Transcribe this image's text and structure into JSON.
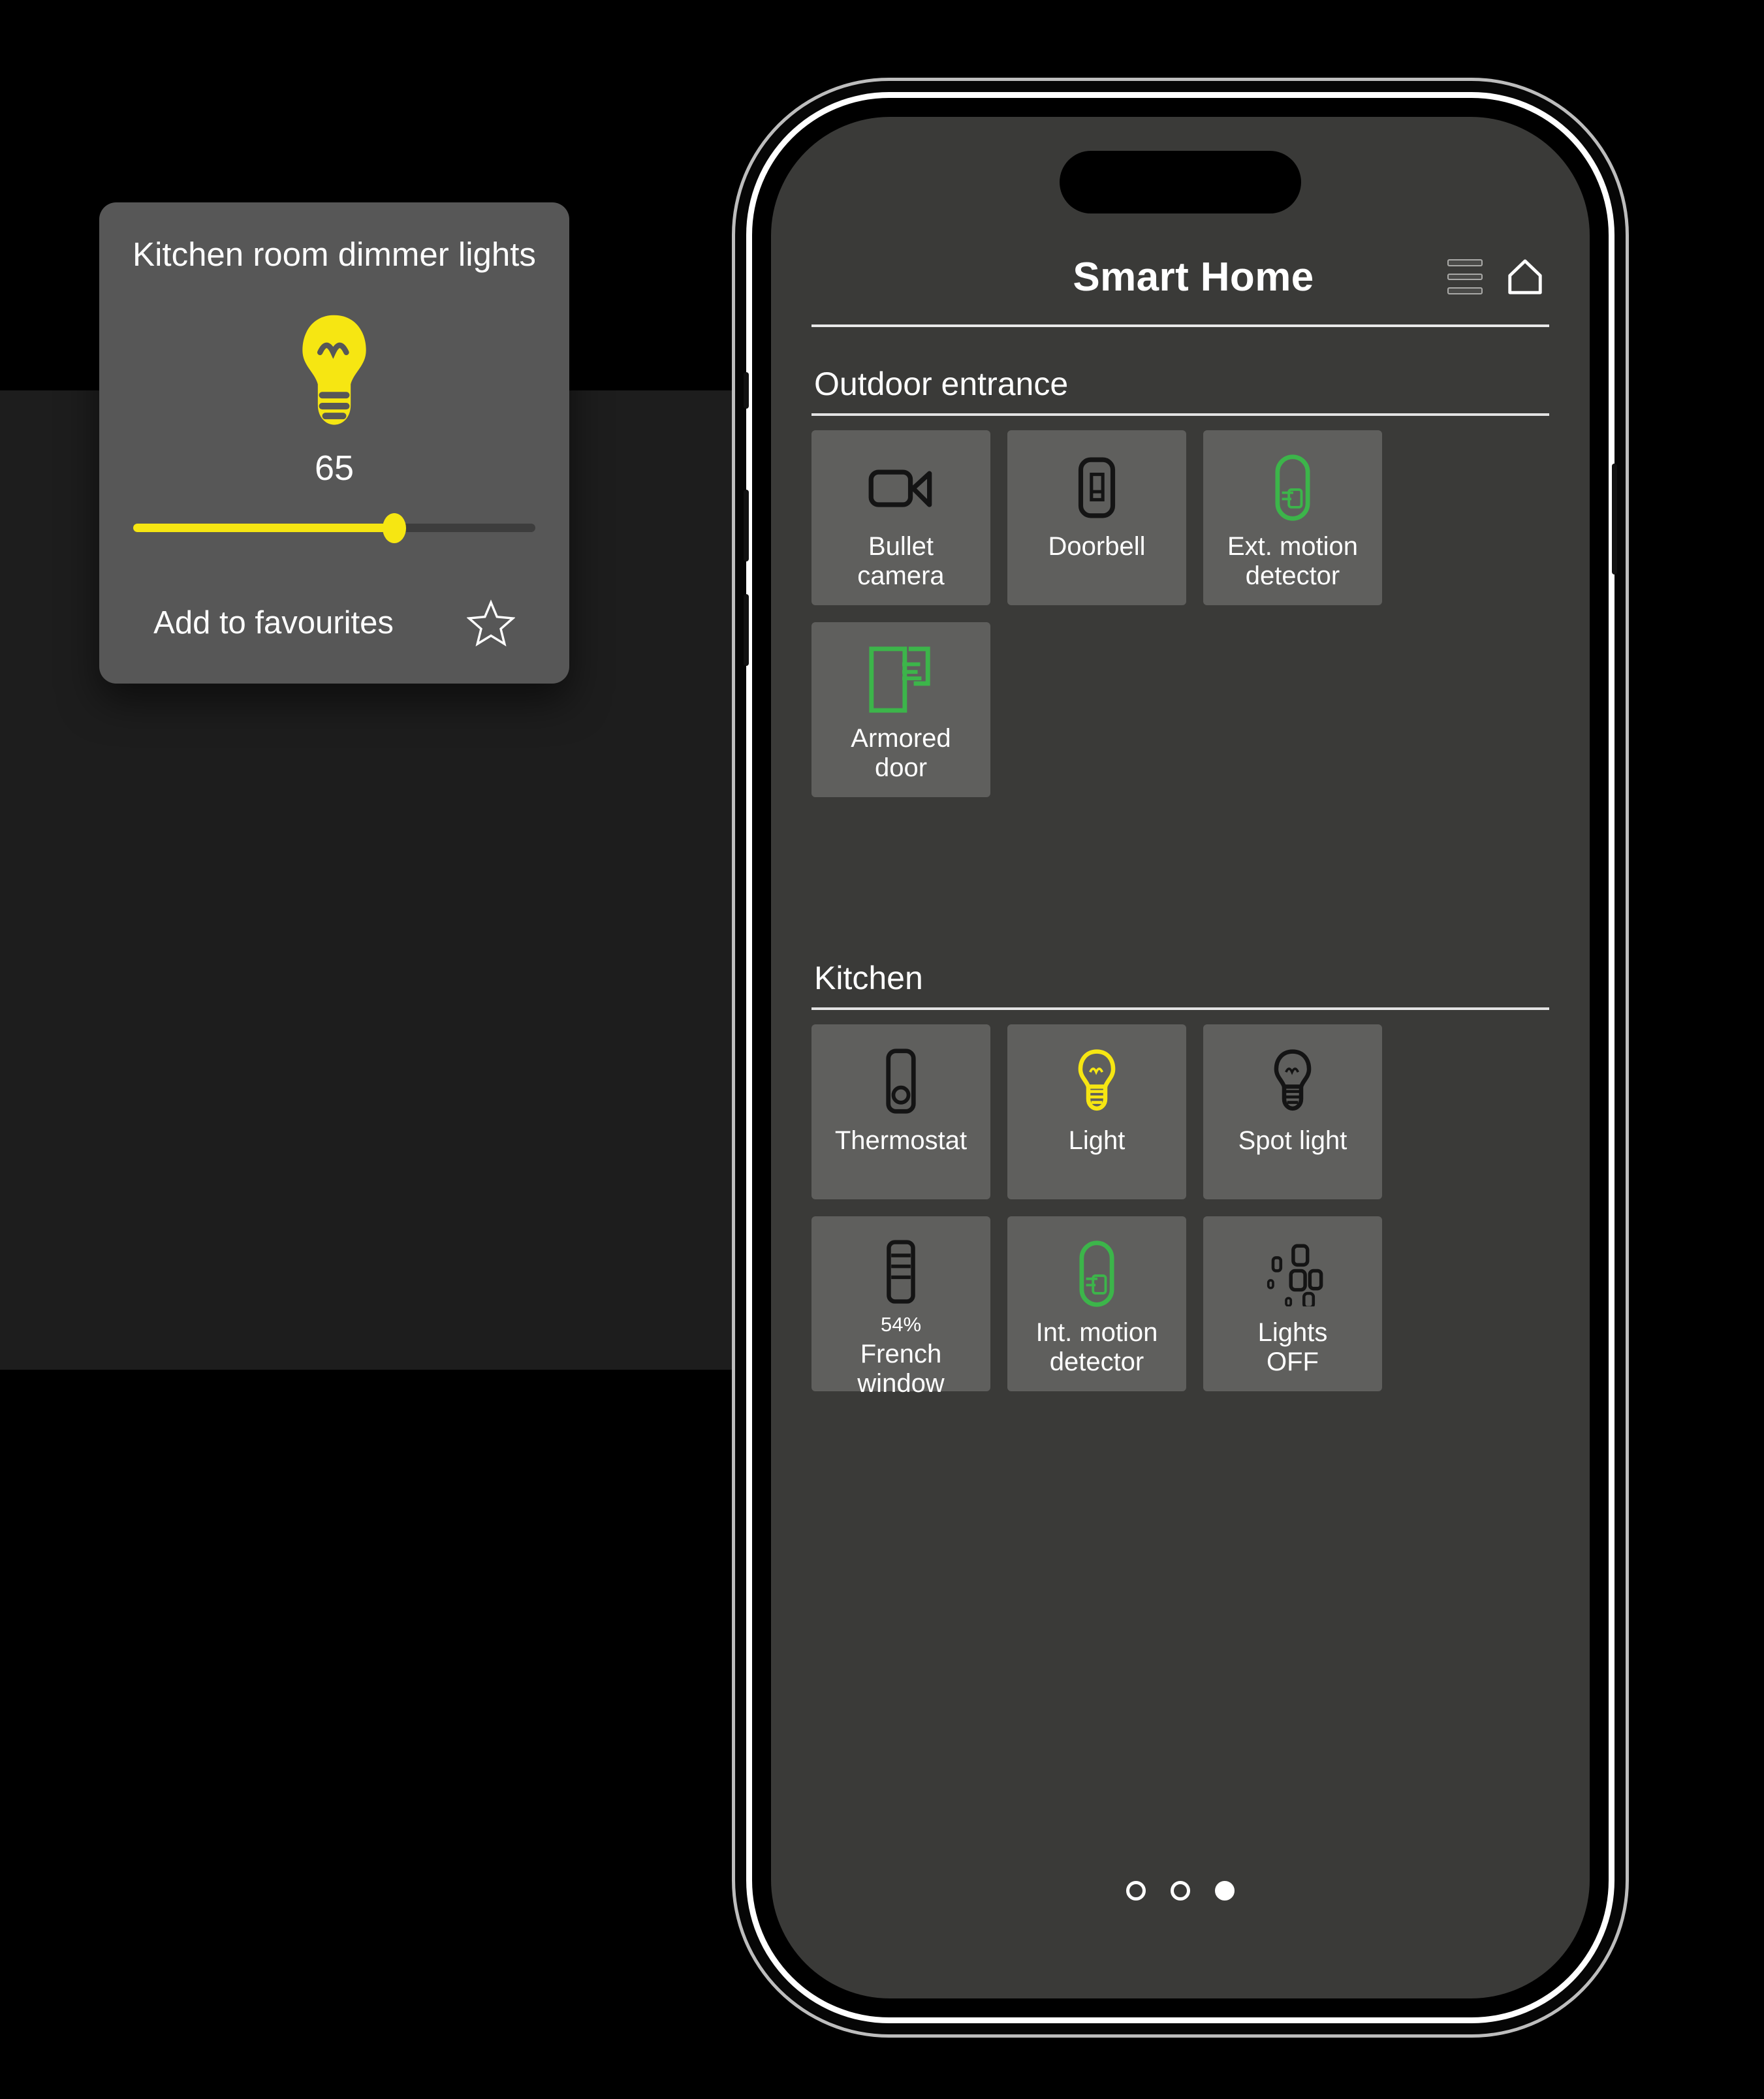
{
  "app": {
    "title": "Smart Home",
    "menu_icon": "hamburger-menu-icon",
    "home_icon": "home-icon"
  },
  "sections": [
    {
      "title": "Outdoor entrance",
      "tiles": [
        {
          "label": "Bullet\ncamera",
          "icon": "video-camera-icon",
          "color": "#141414",
          "state": "off"
        },
        {
          "label": "Doorbell",
          "icon": "doorbell-icon",
          "color": "#141414",
          "state": "off"
        },
        {
          "label": "Ext. motion\ndetector",
          "icon": "motion-detector-icon",
          "color": "#3cb54a",
          "state": "on"
        },
        {
          "label": "Armored\ndoor",
          "icon": "armored-door-icon",
          "color": "#3cb54a",
          "state": "on"
        }
      ]
    },
    {
      "title": "Kitchen",
      "tiles": [
        {
          "label": "Thermostat",
          "icon": "thermostat-icon",
          "color": "#141414",
          "state": "off"
        },
        {
          "label": "Light",
          "icon": "light-bulb-icon",
          "color": "#f6e612",
          "state": "on"
        },
        {
          "label": "Spot light",
          "icon": "light-bulb-icon",
          "color": "#141414",
          "state": "off"
        },
        {
          "label": "French\nwindow",
          "icon": "shutter-icon",
          "color": "#141414",
          "state": "off",
          "value": "54%"
        },
        {
          "label": "Int. motion\ndetector",
          "icon": "motion-detector-icon",
          "color": "#3cb54a",
          "state": "on"
        },
        {
          "label": "Lights\nOFF",
          "icon": "lights-off-scene-icon",
          "color": "#141414",
          "state": "off"
        }
      ]
    }
  ],
  "pagination": {
    "count": 3,
    "active_index": 2
  },
  "dialog": {
    "title": "Kitchen room dimmer lights",
    "bulb_icon": "light-bulb-filled-icon",
    "value": "65",
    "slider": {
      "min": 0,
      "max": 100,
      "value": 65,
      "fill_color": "#f6e612",
      "track_color": "#3d3d3d"
    },
    "favourite_label": "Add to favourites",
    "favourite_icon": "star-outline-icon",
    "favourite_active": false
  },
  "colors": {
    "accent_yellow": "#f6e612",
    "accent_green": "#3cb54a",
    "tile_bg": "#5f5f5d",
    "screen_bg": "#3a3a38",
    "dialog_bg": "#575757"
  }
}
